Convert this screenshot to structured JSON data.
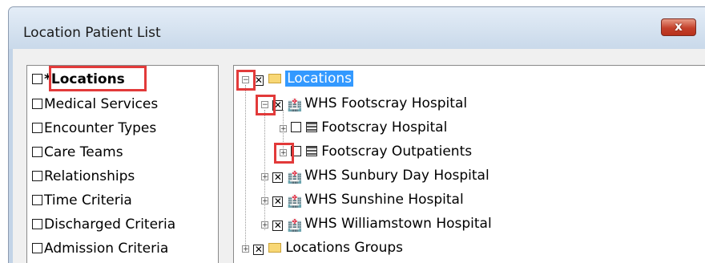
{
  "window": {
    "title": "Location Patient List",
    "close_label": "x"
  },
  "left_panel": {
    "items": [
      {
        "label": "*Locations"
      },
      {
        "label": "Medical Services"
      },
      {
        "label": "Encounter Types"
      },
      {
        "label": "Care Teams"
      },
      {
        "label": "Relationships"
      },
      {
        "label": "Time Criteria"
      },
      {
        "label": "Discharged Criteria"
      },
      {
        "label": "Admission Criteria"
      }
    ]
  },
  "tree": {
    "root_label": "Locations",
    "hospitals": [
      {
        "label": "WHS Footscray Hospital"
      },
      {
        "label": "Footscray Hospital"
      },
      {
        "label": "Footscray Outpatients"
      },
      {
        "label": "WHS Sunbury Day Hospital"
      },
      {
        "label": "WHS Sunshine Hospital"
      },
      {
        "label": "WHS Williamstown Hospital"
      }
    ],
    "groups_label": "Locations Groups",
    "expander_plus": "+",
    "expander_minus": "−",
    "check_mark": "✕"
  }
}
